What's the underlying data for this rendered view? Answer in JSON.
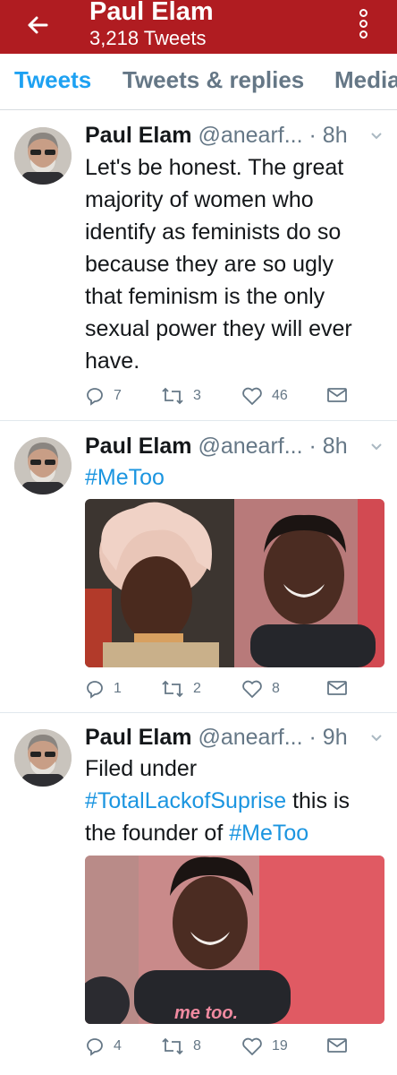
{
  "header": {
    "title": "Paul Elam",
    "subtitle": "3,218 Tweets",
    "back_icon": "arrow-left-icon",
    "menu_icon": "more-vertical-icon"
  },
  "tabs": [
    {
      "label": "Tweets"
    },
    {
      "label": "Tweets & replies"
    },
    {
      "label": "Media"
    }
  ],
  "tweets": [
    {
      "name": "Paul Elam",
      "handle": "@anearf...",
      "time": "· 8h",
      "text_lines": [
        "Let's be honest. The great",
        "majority of women who",
        "identify as feminists do so",
        "because they are so ugly",
        "that feminism is the only",
        "sexual power they will ever",
        "have."
      ],
      "replies": "7",
      "retweets": "3",
      "likes": "46"
    },
    {
      "name": "Paul Elam",
      "handle": "@anearf...",
      "time": "· 8h",
      "hashtag": "#MeToo",
      "replies": "1",
      "retweets": "2",
      "likes": "8"
    },
    {
      "name": "Paul Elam",
      "handle": "@anearf...",
      "time": "· 9h",
      "line1": "Filed under",
      "hashtag1": "#TotalLackofSuprise",
      "line2_rest": " this is",
      "line3_pre": "the founder of ",
      "hashtag2": "#MeToo",
      "shirt_text": "me too.",
      "replies": "4",
      "retweets": "8",
      "likes": "19"
    }
  ],
  "colors": {
    "header_bg": "#b01c21",
    "accent": "#1da1f2",
    "hashtag": "#1b95e0",
    "muted": "#657786"
  }
}
